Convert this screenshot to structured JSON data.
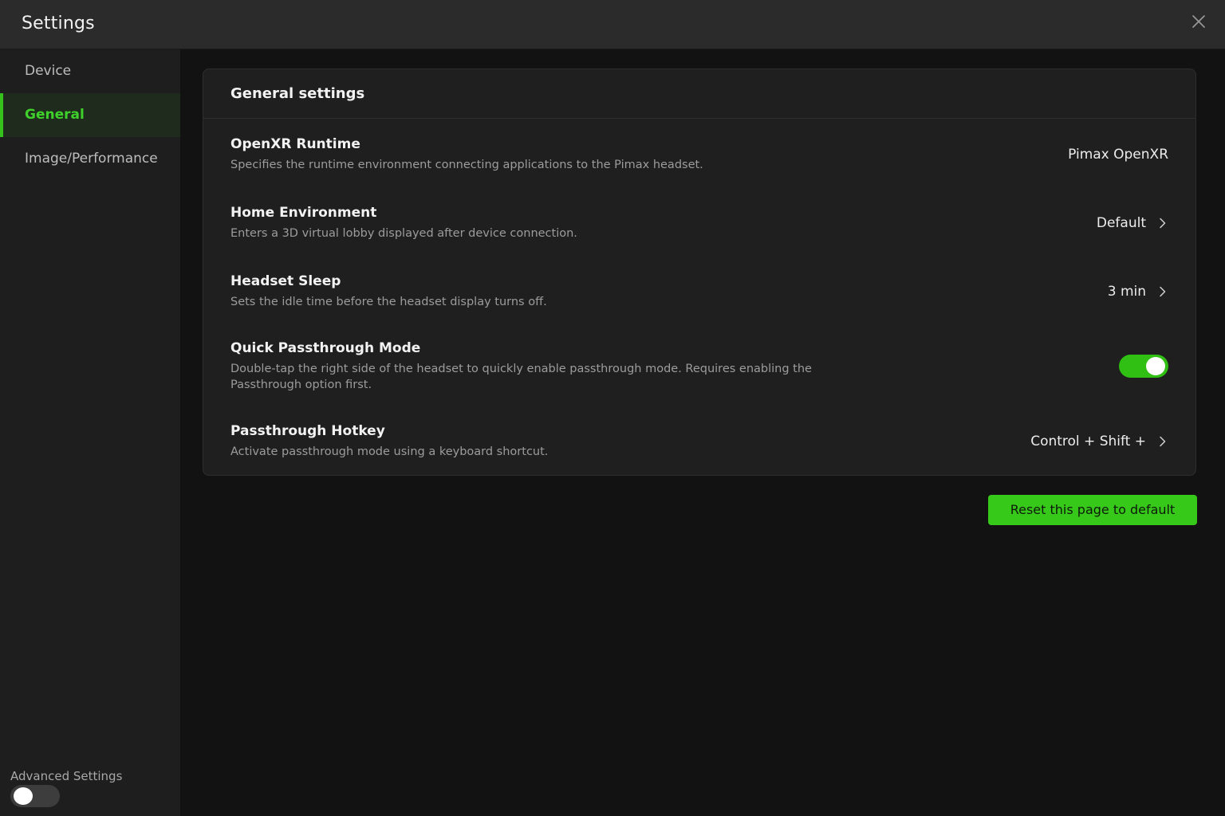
{
  "window": {
    "title": "Settings"
  },
  "sidebar": {
    "items": [
      {
        "label": "Device"
      },
      {
        "label": "General"
      },
      {
        "label": "Image/Performance"
      }
    ],
    "advanced_label": "Advanced Settings"
  },
  "panel": {
    "title": "General settings",
    "rows": [
      {
        "title": "OpenXR Runtime",
        "desc": "Specifies the runtime environment connecting applications to the Pimax headset.",
        "value": "Pimax OpenXR"
      },
      {
        "title": "Home Environment",
        "desc": "Enters a 3D virtual lobby displayed after device connection.",
        "value": "Default"
      },
      {
        "title": "Headset Sleep",
        "desc": "Sets the idle time before the headset display turns off.",
        "value": "3 min"
      },
      {
        "title": "Quick Passthrough Mode",
        "desc": "Double-tap the right side of the headset to quickly enable passthrough mode. Requires enabling the Passthrough option first.",
        "enabled": true
      },
      {
        "title": "Passthrough Hotkey",
        "desc": "Activate passthrough mode using a keyboard shortcut.",
        "value": "Control + Shift +"
      }
    ]
  },
  "actions": {
    "reset_label": "Reset this page to default"
  },
  "colors": {
    "accent": "#36c91a",
    "active_nav_text": "#3fd12b",
    "background": "#121212"
  }
}
